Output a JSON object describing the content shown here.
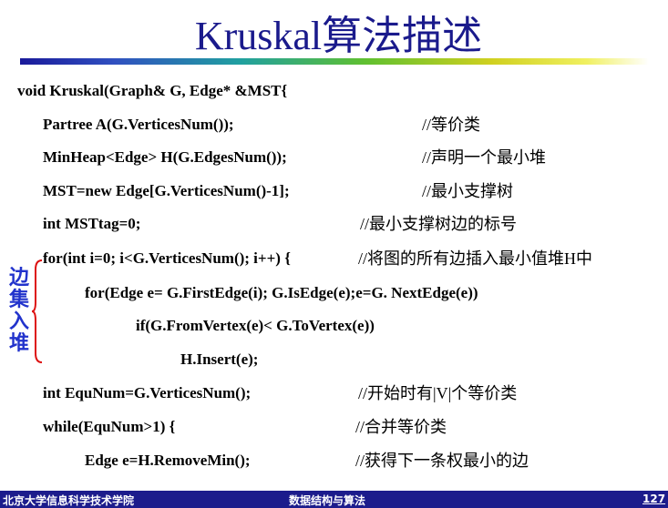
{
  "title": "Kruskal算法描述",
  "code_lines": [
    {
      "code": "void Kruskal(Graph& G, Edge* &MST{",
      "comment": ""
    },
    {
      "code": "Partree A(G.VerticesNum());",
      "comment": "//等价类"
    },
    {
      "code": "MinHeap<Edge> H(G.EdgesNum());",
      "comment": "//声明一个最小堆"
    },
    {
      "code": "MST=new Edge[G.VerticesNum()-1];",
      "comment": "//最小支撑树"
    },
    {
      "code": "int MSTtag=0;",
      "comment": "//最小支撑树边的标号"
    },
    {
      "code": "for(int i=0; i<G.VerticesNum(); i++) {",
      "comment": "//将图的所有边插入最小值堆H中"
    },
    {
      "code": "for(Edge e= G.FirstEdge(i); G.IsEdge(e);e=G. NextEdge(e))",
      "comment": ""
    },
    {
      "code": "if(G.FromVertex(e)< G.ToVertex(e))",
      "comment": ""
    },
    {
      "code": "H.Insert(e);",
      "comment": ""
    },
    {
      "code": "int EquNum=G.VerticesNum();",
      "comment": "//开始时有|V|个等价类"
    },
    {
      "code": "while(EquNum>1) {",
      "comment": "//合并等价类"
    },
    {
      "code": "Edge e=H.RemoveMin();",
      "comment": "//获得下一条权最小的边"
    }
  ],
  "side_label": "边集入堆",
  "footer": {
    "left": "北京大学信息科学技术学院",
    "center": "数据结构与算法",
    "page": "127"
  },
  "colors": {
    "title": "#1a1a8c",
    "side_label": "#2233cc",
    "brace": "#dd1111",
    "footer_bg": "#1c1c8c"
  }
}
